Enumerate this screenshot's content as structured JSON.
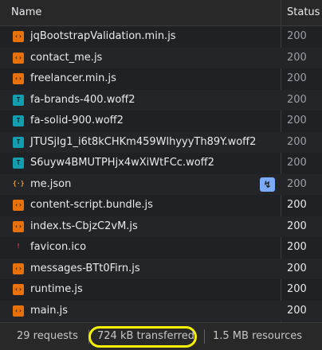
{
  "header": {
    "name_label": "Name",
    "status_label": "Status"
  },
  "rows": [
    {
      "name": "jqBootstrapValidation.min.js",
      "status": "200",
      "icon": "script-icon",
      "dim": true
    },
    {
      "name": "contact_me.js",
      "status": "200",
      "icon": "script-icon",
      "dim": true
    },
    {
      "name": "freelancer.min.js",
      "status": "200",
      "icon": "script-icon",
      "dim": true
    },
    {
      "name": "fa-brands-400.woff2",
      "status": "200",
      "icon": "font-icon",
      "dim": true
    },
    {
      "name": "fa-solid-900.woff2",
      "status": "200",
      "icon": "font-icon",
      "dim": true
    },
    {
      "name": "JTUSjIg1_i6t8kCHKm459WlhyyyTh89Y.woff2",
      "status": "200",
      "icon": "font-icon",
      "dim": true
    },
    {
      "name": "S6uyw4BMUTPHjx4wXiWtFCc.woff2",
      "status": "200",
      "icon": "font-icon",
      "dim": true
    },
    {
      "name": "me.json",
      "status": "200",
      "icon": "json-icon",
      "dim": true
    },
    {
      "name": "content-script.bundle.js",
      "status": "200",
      "icon": "script-icon",
      "dim": false
    },
    {
      "name": "index.ts-CbjzC2vM.js",
      "status": "200",
      "icon": "script-icon",
      "dim": false
    },
    {
      "name": "favicon.ico",
      "status": "200",
      "icon": "favicon-icon",
      "dim": false
    },
    {
      "name": "messages-BTt0Firn.js",
      "status": "200",
      "icon": "script-icon",
      "dim": false
    },
    {
      "name": "runtime.js",
      "status": "200",
      "icon": "script-icon",
      "dim": false
    },
    {
      "name": "main.js",
      "status": "200",
      "icon": "script-icon",
      "dim": false
    }
  ],
  "icons": {
    "script": "‹›",
    "font": "T",
    "json": "{·}",
    "favicon": "!",
    "override": "↯"
  },
  "footer": {
    "requests": "29 requests",
    "transferred": "724 kB transferred",
    "resources": "1.5 MB resources"
  },
  "colors": {
    "highlight": "#f7f300",
    "script_icon": "#e8710a",
    "font_icon": "#129eaf",
    "override_badge": "#7cacf8"
  }
}
